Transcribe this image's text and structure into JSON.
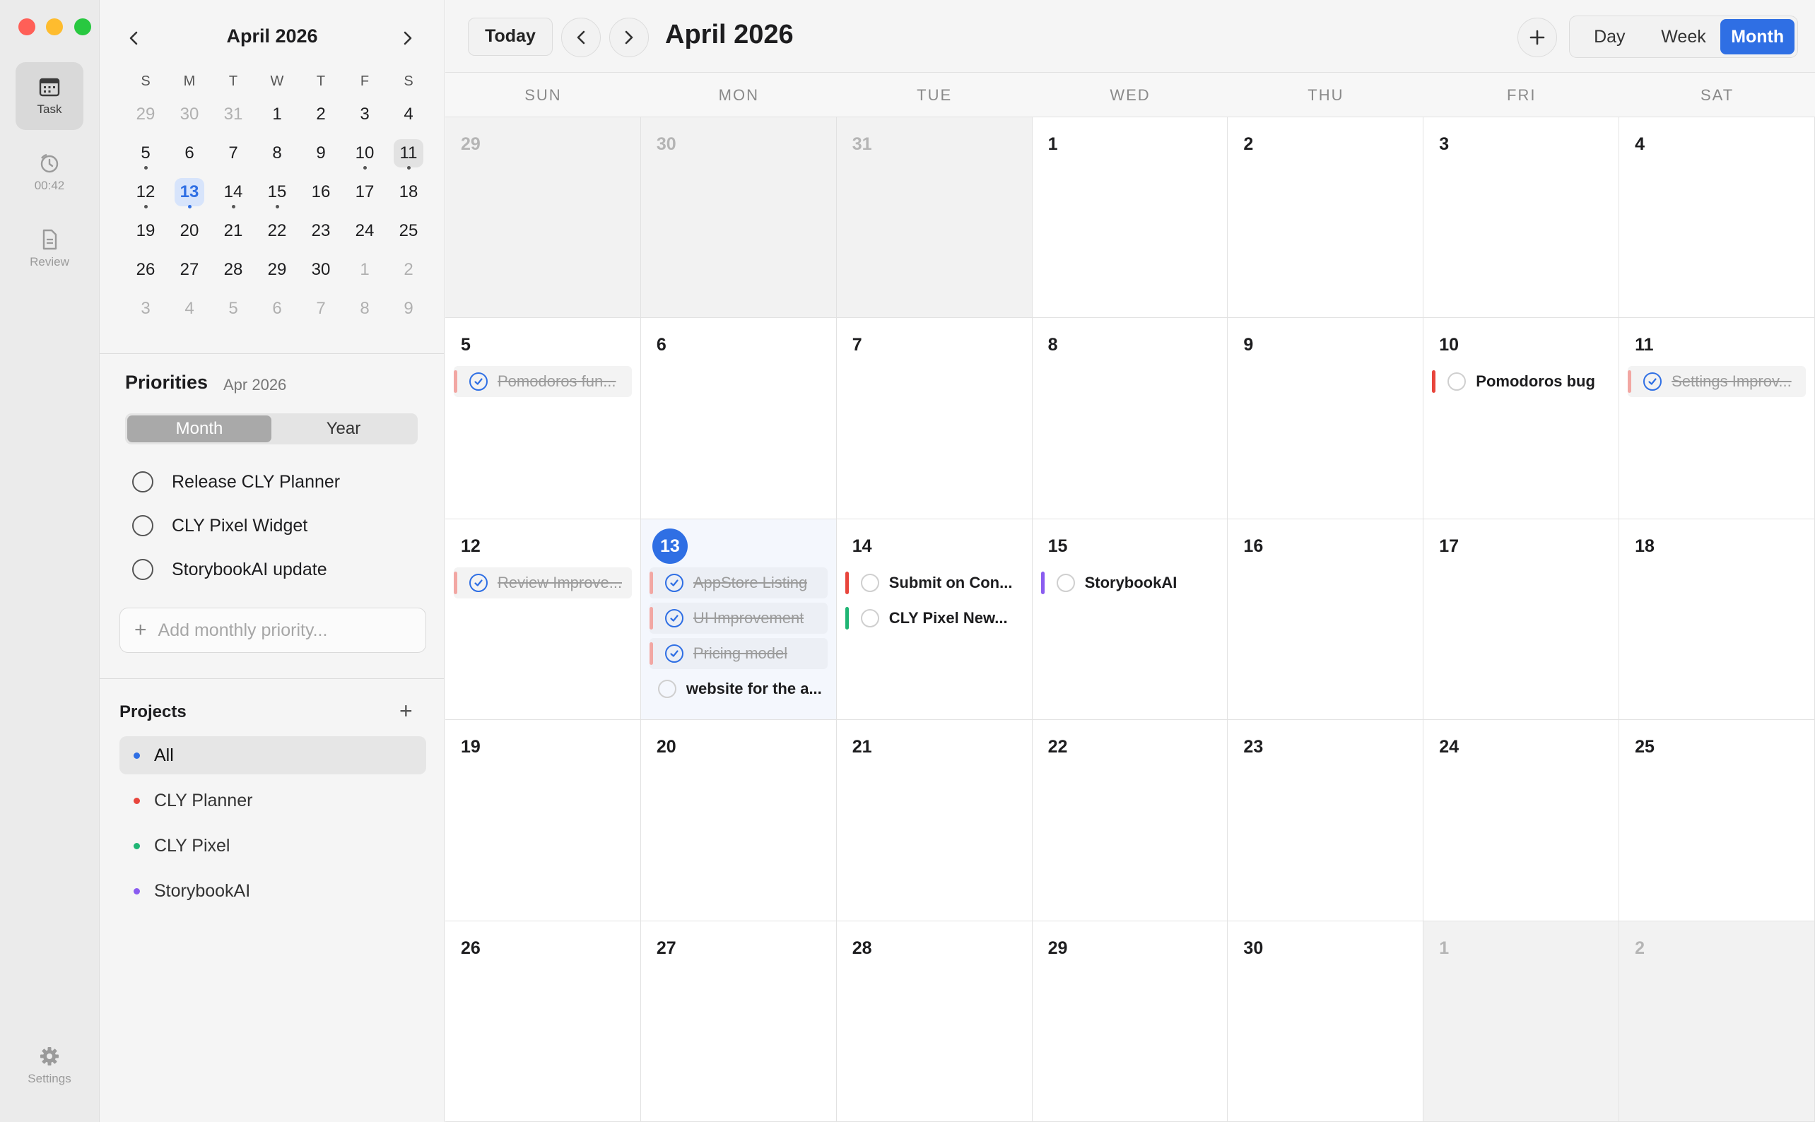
{
  "rail": {
    "items": [
      {
        "label": "Task",
        "icon": "calendar-icon",
        "active": true
      },
      {
        "label": "00:42",
        "icon": "timer-icon",
        "active": false
      },
      {
        "label": "Review",
        "icon": "document-icon",
        "active": false
      }
    ],
    "settings_label": "Settings"
  },
  "mini": {
    "title": "April 2026",
    "weekdays": [
      "S",
      "M",
      "T",
      "W",
      "T",
      "F",
      "S"
    ],
    "days": [
      {
        "n": "29",
        "muted": true
      },
      {
        "n": "30",
        "muted": true
      },
      {
        "n": "31",
        "muted": true
      },
      {
        "n": "1"
      },
      {
        "n": "2"
      },
      {
        "n": "3"
      },
      {
        "n": "4"
      },
      {
        "n": "5",
        "dot": true
      },
      {
        "n": "6"
      },
      {
        "n": "7"
      },
      {
        "n": "8"
      },
      {
        "n": "9"
      },
      {
        "n": "10",
        "dot": true
      },
      {
        "n": "11",
        "dot": true,
        "selected": true
      },
      {
        "n": "12",
        "dot": true
      },
      {
        "n": "13",
        "dot": true,
        "today": true
      },
      {
        "n": "14",
        "dot": true
      },
      {
        "n": "15",
        "dot": true
      },
      {
        "n": "16"
      },
      {
        "n": "17"
      },
      {
        "n": "18"
      },
      {
        "n": "19"
      },
      {
        "n": "20"
      },
      {
        "n": "21"
      },
      {
        "n": "22"
      },
      {
        "n": "23"
      },
      {
        "n": "24"
      },
      {
        "n": "25"
      },
      {
        "n": "26"
      },
      {
        "n": "27"
      },
      {
        "n": "28"
      },
      {
        "n": "29"
      },
      {
        "n": "30"
      },
      {
        "n": "1",
        "muted": true
      },
      {
        "n": "2",
        "muted": true
      },
      {
        "n": "3",
        "muted": true
      },
      {
        "n": "4",
        "muted": true
      },
      {
        "n": "5",
        "muted": true
      },
      {
        "n": "6",
        "muted": true
      },
      {
        "n": "7",
        "muted": true
      },
      {
        "n": "8",
        "muted": true
      },
      {
        "n": "9",
        "muted": true
      }
    ]
  },
  "priorities": {
    "title": "Priorities",
    "period": "Apr 2026",
    "tabs": [
      "Month",
      "Year"
    ],
    "active_tab": "Month",
    "items": [
      "Release CLY Planner",
      "CLY Pixel Widget",
      "StorybookAI update"
    ],
    "add_placeholder": "Add monthly priority..."
  },
  "projects": {
    "title": "Projects",
    "items": [
      {
        "name": "All",
        "color": "#2f6fe4",
        "active": true
      },
      {
        "name": "CLY Planner",
        "color": "#e8453c"
      },
      {
        "name": "CLY Pixel",
        "color": "#1fb574"
      },
      {
        "name": "StorybookAI",
        "color": "#8a5cf0"
      }
    ]
  },
  "toolbar": {
    "today_label": "Today",
    "title": "April 2026",
    "views": [
      "Day",
      "Week",
      "Month"
    ],
    "active_view": "Month"
  },
  "calendar": {
    "weekdays": [
      "SUN",
      "MON",
      "TUE",
      "WED",
      "THU",
      "FRI",
      "SAT"
    ],
    "colors": {
      "red": "#e8453c",
      "pink": "#f2a7a3",
      "green": "#1fb574",
      "purple": "#8a5cf0"
    },
    "days": [
      {
        "n": "29",
        "other": true
      },
      {
        "n": "30",
        "other": true
      },
      {
        "n": "31",
        "other": true
      },
      {
        "n": "1"
      },
      {
        "n": "2"
      },
      {
        "n": "3"
      },
      {
        "n": "4"
      },
      {
        "n": "5",
        "events": [
          {
            "text": "Pomodoros fun...",
            "done": true,
            "bar": "#f2a7a3"
          }
        ]
      },
      {
        "n": "6"
      },
      {
        "n": "7"
      },
      {
        "n": "8"
      },
      {
        "n": "9"
      },
      {
        "n": "10",
        "events": [
          {
            "text": "Pomodoros bug",
            "done": false,
            "bar": "#e8453c"
          }
        ]
      },
      {
        "n": "11",
        "events": [
          {
            "text": "Settings Improv...",
            "done": true,
            "bar": "#f2a7a3"
          }
        ]
      },
      {
        "n": "12",
        "events": [
          {
            "text": "Review Improve...",
            "done": true,
            "bar": "#f2a7a3"
          }
        ]
      },
      {
        "n": "13",
        "today": true,
        "events": [
          {
            "text": "AppStore Listing",
            "done": true,
            "bar": "#f2a7a3"
          },
          {
            "text": "UI Improvement",
            "done": true,
            "bar": "#f2a7a3"
          },
          {
            "text": "Pricing model",
            "done": true,
            "bar": "#f2a7a3"
          },
          {
            "text": "website for the a...",
            "done": false,
            "bar": ""
          }
        ]
      },
      {
        "n": "14",
        "events": [
          {
            "text": "Submit on Con...",
            "done": false,
            "bar": "#e8453c"
          },
          {
            "text": "CLY Pixel New...",
            "done": false,
            "bar": "#1fb574"
          }
        ]
      },
      {
        "n": "15",
        "events": [
          {
            "text": "StorybookAI",
            "done": false,
            "bar": "#8a5cf0"
          }
        ]
      },
      {
        "n": "16"
      },
      {
        "n": "17"
      },
      {
        "n": "18"
      },
      {
        "n": "19"
      },
      {
        "n": "20"
      },
      {
        "n": "21"
      },
      {
        "n": "22"
      },
      {
        "n": "23"
      },
      {
        "n": "24"
      },
      {
        "n": "25"
      },
      {
        "n": "26"
      },
      {
        "n": "27"
      },
      {
        "n": "28"
      },
      {
        "n": "29"
      },
      {
        "n": "30"
      },
      {
        "n": "1",
        "other": true
      },
      {
        "n": "2",
        "other": true
      }
    ]
  }
}
